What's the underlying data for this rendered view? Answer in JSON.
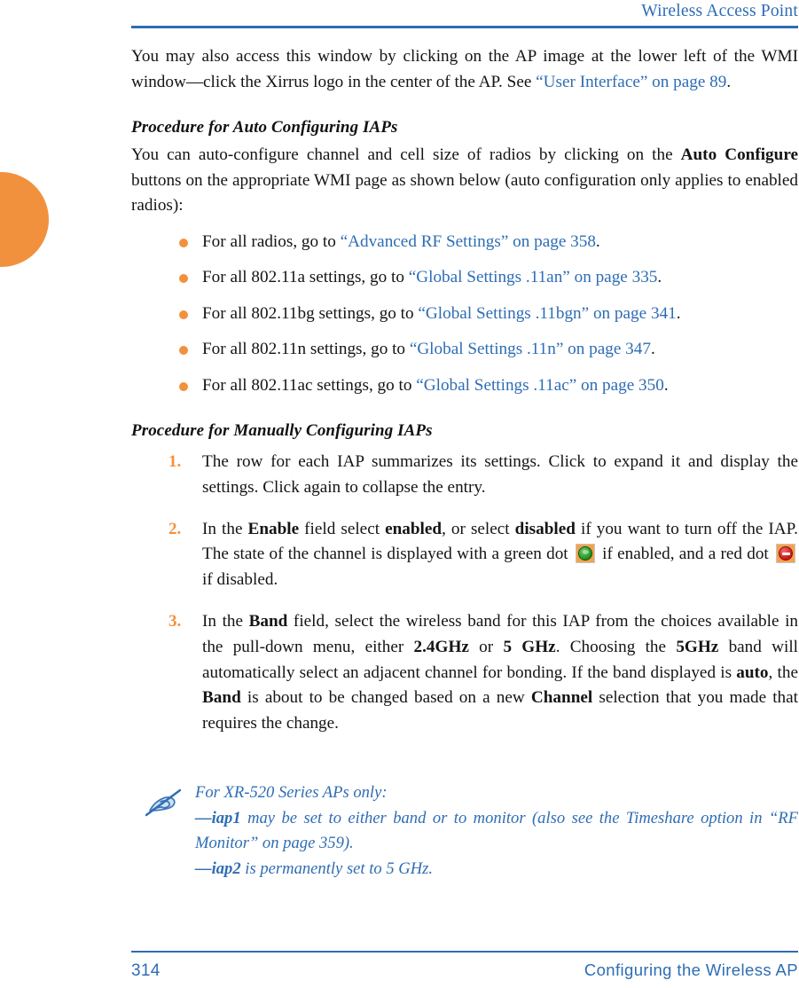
{
  "header": {
    "title": "Wireless Access Point"
  },
  "intro": {
    "part1": "You may also access this window by clicking on the AP image at the lower left of the WMI window",
    "dash": "—",
    "part2": "click the Xirrus logo in the center of the AP. See ",
    "link": "“User Interface” on page 89",
    "part3": "."
  },
  "auto_section": {
    "heading": "Procedure for Auto Configuring IAPs",
    "paragraph_1": "You can auto-configure channel and cell size of radios by clicking on the ",
    "bold_1": "Auto Configure",
    "paragraph_2": " buttons on the appropriate WMI page as shown below (auto configuration only applies to enabled radios):",
    "bullets": [
      {
        "text": "For all radios, go to ",
        "link": "“Advanced RF Settings” on page 358",
        "tail": "."
      },
      {
        "text": "For all 802.11a settings, go to ",
        "link": "“Global Settings .11an” on page 335",
        "tail": "."
      },
      {
        "text": "For all 802.11bg settings, go to ",
        "link": "“Global Settings .11bgn” on page 341",
        "tail": "."
      },
      {
        "text": "For all 802.11n settings, go to ",
        "link": "“Global Settings .11n” on page 347",
        "tail": "."
      },
      {
        "text": "For all 802.11ac settings, go to ",
        "link": "“Global Settings .11ac” on page 350",
        "tail": "."
      }
    ]
  },
  "manual_section": {
    "heading": "Procedure for Manually Configuring IAPs",
    "steps": [
      {
        "number": "1.",
        "text": "The row for each IAP summarizes its settings. Click to expand it and display the settings. Click again to collapse the entry."
      },
      {
        "number": "2.",
        "s1": "In the ",
        "b1": "Enable",
        "s2": " field select ",
        "b2": "enabled",
        "s3": ", or select ",
        "b3": "disabled",
        "s4": " if you want to turn off the IAP. The state of the channel is displayed with a green dot ",
        "icon_green": "green-status-dot-icon",
        "s5": " if enabled, and a red dot ",
        "icon_red": "red-status-dot-icon",
        "s6": " if disabled."
      },
      {
        "number": "3.",
        "s1": "In the ",
        "b1": "Band",
        "s2": " field, select the wireless band for this IAP from the choices available in the pull-down menu, either ",
        "b2": "2.4GHz",
        "s3": " or ",
        "b3": "5 GHz",
        "s4": ". Choosing the ",
        "b4": "5GHz",
        "s5": " band will automatically select an adjacent channel for bonding. If the band displayed is ",
        "b5": "auto",
        "s6": ", the ",
        "b6": "Band",
        "s7": " is about to be changed based on a new ",
        "b7": "Channel",
        "s8": " selection that you made that requires the change."
      }
    ]
  },
  "note": {
    "icon": "note-pencil-icon",
    "line1": "For XR-520 Series APs only:",
    "line2_dash": "—",
    "line2_bold": "iap1",
    "line2_rest": " may be set to either band or to monitor (also see the Timeshare option in “RF Monitor” on page 359).",
    "line3_dash": "—",
    "line3_bold": "iap2",
    "line3_rest": " is permanently set to 5 GHz."
  },
  "footer": {
    "page_number": "314",
    "section_title": "Configuring the Wireless AP"
  },
  "colors": {
    "accent_blue": "#2E6DB4",
    "accent_orange": "#F2913D",
    "body_text": "#141414"
  }
}
